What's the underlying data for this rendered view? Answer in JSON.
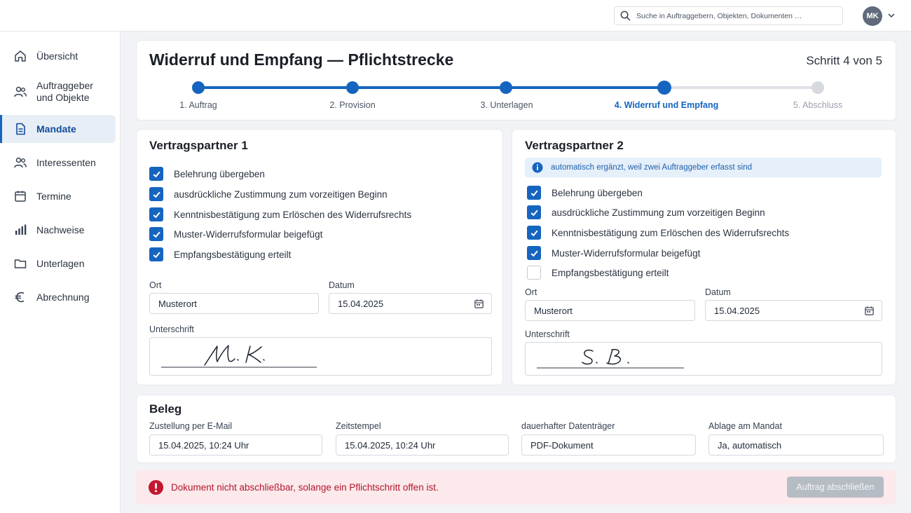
{
  "header": {
    "search_placeholder": "Suche in Auftraggebern, Objekten, Dokumenten …",
    "avatar_initials": "MK"
  },
  "sidebar": {
    "items": [
      {
        "label": "Übersicht",
        "icon": "home-icon"
      },
      {
        "label": "Auftraggeber\nund Objekte",
        "icon": "users-icon"
      },
      {
        "label": "Mandate",
        "icon": "document-icon",
        "active": true
      },
      {
        "label": "Interessenten",
        "icon": "users-icon"
      },
      {
        "label": "Termine",
        "icon": "calendar-icon"
      },
      {
        "label": "Nachweise",
        "icon": "bar-chart-icon"
      },
      {
        "label": "Unterlagen",
        "icon": "folder-icon"
      },
      {
        "label": "Abrechnung",
        "icon": "euro-icon"
      }
    ]
  },
  "wizard": {
    "title": "Widerruf und Empfang — Pflichtstrecke",
    "step_count": "Schritt 4 von 5",
    "steps": [
      {
        "label": "1. Auftrag",
        "state": "done"
      },
      {
        "label": "2. Provision",
        "state": "done"
      },
      {
        "label": "3. Unterlagen",
        "state": "done"
      },
      {
        "label": "4. Widerruf und Empfang",
        "state": "current"
      },
      {
        "label": "5. Abschluss",
        "state": "todo"
      }
    ]
  },
  "partner1": {
    "title": "Vertragspartner 1",
    "checks": [
      {
        "label": "Belehrung übergeben",
        "checked": true
      },
      {
        "label": "ausdrückliche Zustimmung zum vorzeitigen Beginn",
        "checked": true
      },
      {
        "label": "Kenntnisbestätigung zum Erlöschen des Widerrufsrechts",
        "checked": true
      },
      {
        "label": "Muster-Widerrufsformular beigefügt",
        "checked": true
      },
      {
        "label": "Empfangsbestätigung erteilt",
        "checked": true
      }
    ],
    "ort_label": "Ort",
    "ort_value": "Musterort",
    "datum_label": "Datum",
    "datum_value": "15.04.2025",
    "signature_label": "Unterschrift",
    "signature_text": "M. K."
  },
  "partner2": {
    "title": "Vertragspartner 2",
    "info": "automatisch ergänzt, weil zwei Auftraggeber erfasst sind",
    "checks": [
      {
        "label": "Belehrung übergeben",
        "checked": true
      },
      {
        "label": "ausdrückliche Zustimmung zum vorzeitigen Beginn",
        "checked": true
      },
      {
        "label": "Kenntnisbestätigung zum Erlöschen des Widerrufsrechts",
        "checked": true
      },
      {
        "label": "Muster-Widerrufsformular beigefügt",
        "checked": true
      },
      {
        "label": "Empfangsbestätigung erteilt",
        "checked": false
      }
    ],
    "ort_label": "Ort",
    "ort_value": "Musterort",
    "datum_label": "Datum",
    "datum_value": "15.04.2025",
    "signature_label": "Unterschrift",
    "signature_text": "S. B."
  },
  "beleg": {
    "title": "Beleg",
    "fields": [
      {
        "label": "Zustellung per E-Mail",
        "value": "15.04.2025, 10:24 Uhr"
      },
      {
        "label": "Zeitstempel",
        "value": "15.04.2025, 10:24 Uhr"
      },
      {
        "label": "dauerhafter Datenträger",
        "value": "PDF-Dokument"
      },
      {
        "label": "Ablage am Mandat",
        "value": "Ja, automatisch"
      }
    ]
  },
  "footer": {
    "error_text": "Dokument nicht abschließbar, solange ein Pflichtschritt offen ist.",
    "finish_button": "Auftrag abschließen"
  },
  "colors": {
    "accent": "#1565c0",
    "error": "#b3152b",
    "error_bg": "#fbe9ec",
    "info_bg": "#e6f0fa"
  }
}
